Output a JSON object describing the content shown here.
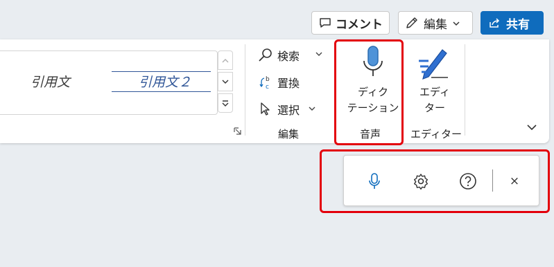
{
  "header": {
    "comment_label": "コメント",
    "edit_label": "編集",
    "share_label": "共有",
    "share_color": "#0f6cbd"
  },
  "ribbon": {
    "styles": {
      "items": [
        "引用文",
        "引用文２"
      ]
    },
    "edit_group": {
      "find_label": "検索",
      "replace_label": "置換",
      "select_label": "選択",
      "group_label": "編集"
    },
    "voice_group": {
      "dictate_line1": "ディク",
      "dictate_line2": "テーション",
      "group_label": "音声",
      "mic_color": "#0f6cbd"
    },
    "editor_group": {
      "editor_line1": "エディ",
      "editor_line2": "ター",
      "group_label": "エディター"
    }
  },
  "highlight_color": "#e3000b",
  "dictation_toolbar": {
    "icons": [
      "microphone-icon",
      "gear-icon",
      "help-icon",
      "close-icon"
    ],
    "close_glyph": "×"
  }
}
